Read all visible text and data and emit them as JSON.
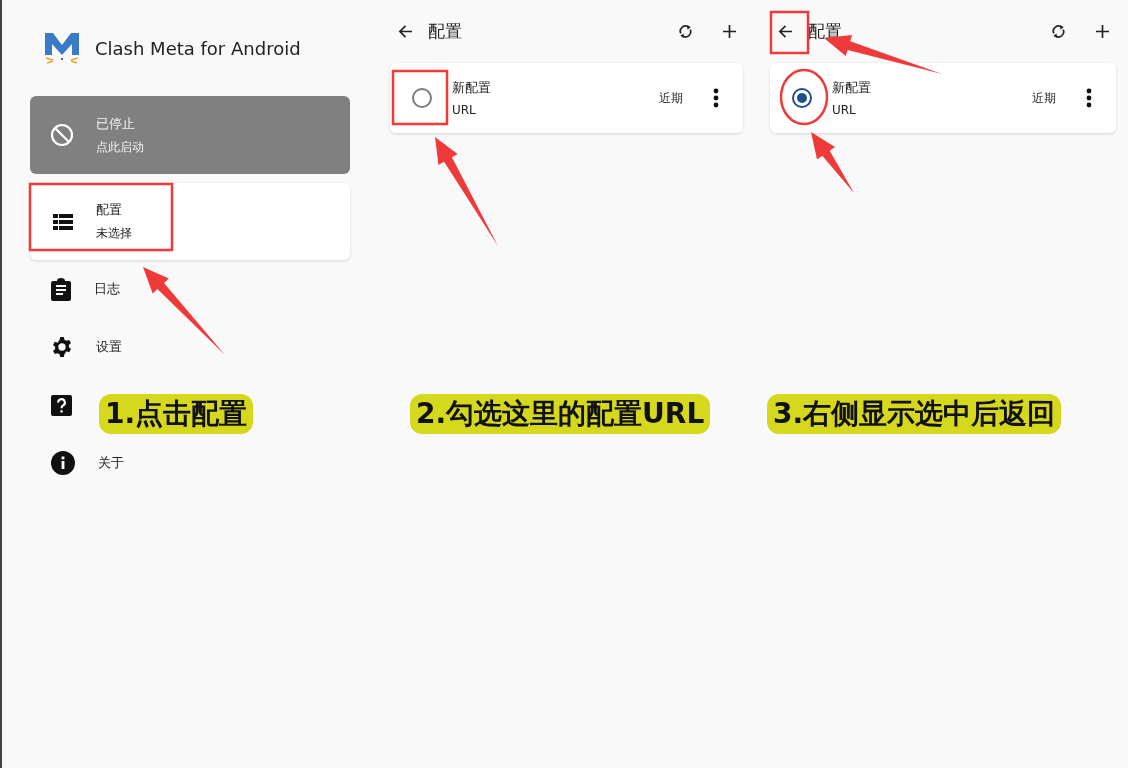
{
  "app": {
    "title": "Clash Meta for Android"
  },
  "status_card": {
    "title": "已停止",
    "subtitle": "点此启动"
  },
  "nav_items": [
    {
      "kind": "profiles",
      "title": "配置",
      "subtitle": "未选择"
    },
    {
      "kind": "logs",
      "title": "日志"
    },
    {
      "kind": "settings",
      "title": "设置"
    },
    {
      "kind": "help"
    },
    {
      "kind": "about",
      "title": "关于"
    }
  ],
  "screens": [
    {
      "title": "配置",
      "profiles": [
        {
          "name": "新配置",
          "type": "URL",
          "updated": "近期",
          "selected": false
        }
      ]
    },
    {
      "title": "配置",
      "profiles": [
        {
          "name": "新配置",
          "type": "URL",
          "updated": "近期",
          "selected": true
        }
      ]
    }
  ],
  "annotations": [
    {
      "text": "1.点击配置"
    },
    {
      "text": "2.勾选这里的配置URL"
    },
    {
      "text": "3.右侧显示选中后返回"
    }
  ]
}
